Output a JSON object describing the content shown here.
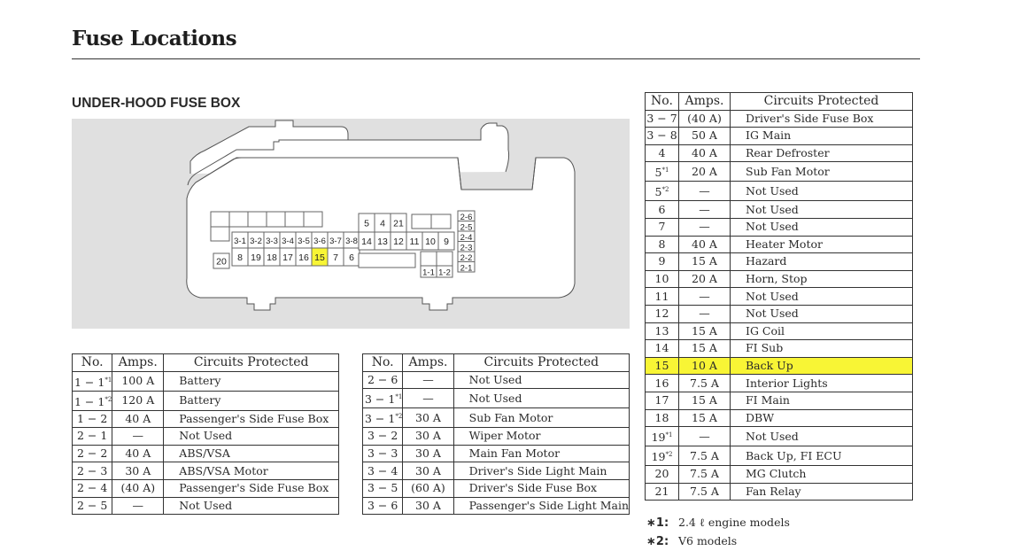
{
  "page": {
    "title": "Fuse Locations",
    "section_title": "UNDER-HOOD FUSE BOX"
  },
  "highlight_color": "#f8f535",
  "diagram": {
    "highlighted_fuse": "15",
    "top_row_left_blank_count": 6,
    "row_3x": [
      "3-1",
      "3-2",
      "3-3",
      "3-4",
      "3-5",
      "3-6",
      "3-7",
      "3-8"
    ],
    "row_main": [
      "8",
      "19",
      "18",
      "17",
      "16",
      "15",
      "7",
      "6"
    ],
    "left_single": "20",
    "top_mid": [
      "5",
      "4",
      "21"
    ],
    "mid_row": [
      "14",
      "13",
      "12",
      "11",
      "10",
      "9"
    ],
    "bottom_small": [
      "1-1",
      "1-2"
    ],
    "right_stack": [
      "2-6",
      "2-5",
      "2-4",
      "2-3",
      "2-2",
      "2-1"
    ]
  },
  "table_headers": {
    "no": "No.",
    "amps": "Amps.",
    "circuits": "Circuits Protected"
  },
  "tables": [
    {
      "rows": [
        {
          "no": "1 − 1",
          "sup": "*1",
          "amps": "100 A",
          "circuit": "Battery"
        },
        {
          "no": "1 − 1",
          "sup": "*2",
          "amps": "120 A",
          "circuit": "Battery"
        },
        {
          "no": "1 − 2",
          "sup": "",
          "amps": "40 A",
          "circuit": "Passenger's Side Fuse Box"
        },
        {
          "no": "2 − 1",
          "sup": "",
          "amps": "—",
          "circuit": "Not Used"
        },
        {
          "no": "2 − 2",
          "sup": "",
          "amps": "40 A",
          "circuit": "ABS/VSA"
        },
        {
          "no": "2 − 3",
          "sup": "",
          "amps": "30 A",
          "circuit": "ABS/VSA Motor"
        },
        {
          "no": "2 − 4",
          "sup": "",
          "amps": "(40 A)",
          "circuit": "Passenger's Side Fuse Box"
        },
        {
          "no": "2 − 5",
          "sup": "",
          "amps": "—",
          "circuit": "Not Used"
        }
      ]
    },
    {
      "rows": [
        {
          "no": "2 − 6",
          "sup": "",
          "amps": "—",
          "circuit": "Not Used"
        },
        {
          "no": "3 − 1",
          "sup": "*1",
          "amps": "—",
          "circuit": "Not Used"
        },
        {
          "no": "3 − 1",
          "sup": "*2",
          "amps": "30 A",
          "circuit": "Sub Fan Motor"
        },
        {
          "no": "3 − 2",
          "sup": "",
          "amps": "30 A",
          "circuit": "Wiper Motor"
        },
        {
          "no": "3 − 3",
          "sup": "",
          "amps": "30 A",
          "circuit": "Main Fan Motor"
        },
        {
          "no": "3 − 4",
          "sup": "",
          "amps": "30 A",
          "circuit": "Driver's Side Light Main"
        },
        {
          "no": "3 − 5",
          "sup": "",
          "amps": "(60 A)",
          "circuit": "Driver's Side Fuse Box"
        },
        {
          "no": "3 − 6",
          "sup": "",
          "amps": "30 A",
          "circuit": "Passenger's Side Light Main"
        }
      ]
    },
    {
      "rows": [
        {
          "no": "3 − 7",
          "sup": "",
          "amps": "(40 A)",
          "circuit": "Driver's Side Fuse Box"
        },
        {
          "no": "3 − 8",
          "sup": "",
          "amps": "50 A",
          "circuit": "IG Main"
        },
        {
          "no": "4",
          "sup": "",
          "amps": "40 A",
          "circuit": "Rear Defroster"
        },
        {
          "no": "5",
          "sup": "*1",
          "amps": "20 A",
          "circuit": "Sub Fan Motor"
        },
        {
          "no": "5",
          "sup": "*2",
          "amps": "—",
          "circuit": "Not Used"
        },
        {
          "no": "6",
          "sup": "",
          "amps": "—",
          "circuit": "Not Used"
        },
        {
          "no": "7",
          "sup": "",
          "amps": "—",
          "circuit": "Not Used"
        },
        {
          "no": "8",
          "sup": "",
          "amps": "40 A",
          "circuit": "Heater Motor"
        },
        {
          "no": "9",
          "sup": "",
          "amps": "15 A",
          "circuit": "Hazard"
        },
        {
          "no": "10",
          "sup": "",
          "amps": "20 A",
          "circuit": "Horn, Stop"
        },
        {
          "no": "11",
          "sup": "",
          "amps": "—",
          "circuit": "Not Used"
        },
        {
          "no": "12",
          "sup": "",
          "amps": "—",
          "circuit": "Not Used"
        },
        {
          "no": "13",
          "sup": "",
          "amps": "15 A",
          "circuit": "IG Coil"
        },
        {
          "no": "14",
          "sup": "",
          "amps": "15 A",
          "circuit": "FI Sub"
        },
        {
          "no": "15",
          "sup": "",
          "amps": "10 A",
          "circuit": "Back Up",
          "highlighted": true
        },
        {
          "no": "16",
          "sup": "",
          "amps": "7.5 A",
          "circuit": "Interior Lights"
        },
        {
          "no": "17",
          "sup": "",
          "amps": "15 A",
          "circuit": "FI Main"
        },
        {
          "no": "18",
          "sup": "",
          "amps": "15 A",
          "circuit": "DBW"
        },
        {
          "no": "19",
          "sup": "*1",
          "amps": "—",
          "circuit": "Not Used"
        },
        {
          "no": "19",
          "sup": "*2",
          "amps": "7.5 A",
          "circuit": "Back Up, FI ECU"
        },
        {
          "no": "20",
          "sup": "",
          "amps": "7.5 A",
          "circuit": "MG Clutch"
        },
        {
          "no": "21",
          "sup": "",
          "amps": "7.5 A",
          "circuit": "Fan Relay"
        }
      ]
    }
  ],
  "footnotes": [
    {
      "mark": "∗1:",
      "text": "2.4 ℓ engine models"
    },
    {
      "mark": "∗2:",
      "text": "V6 models"
    }
  ]
}
